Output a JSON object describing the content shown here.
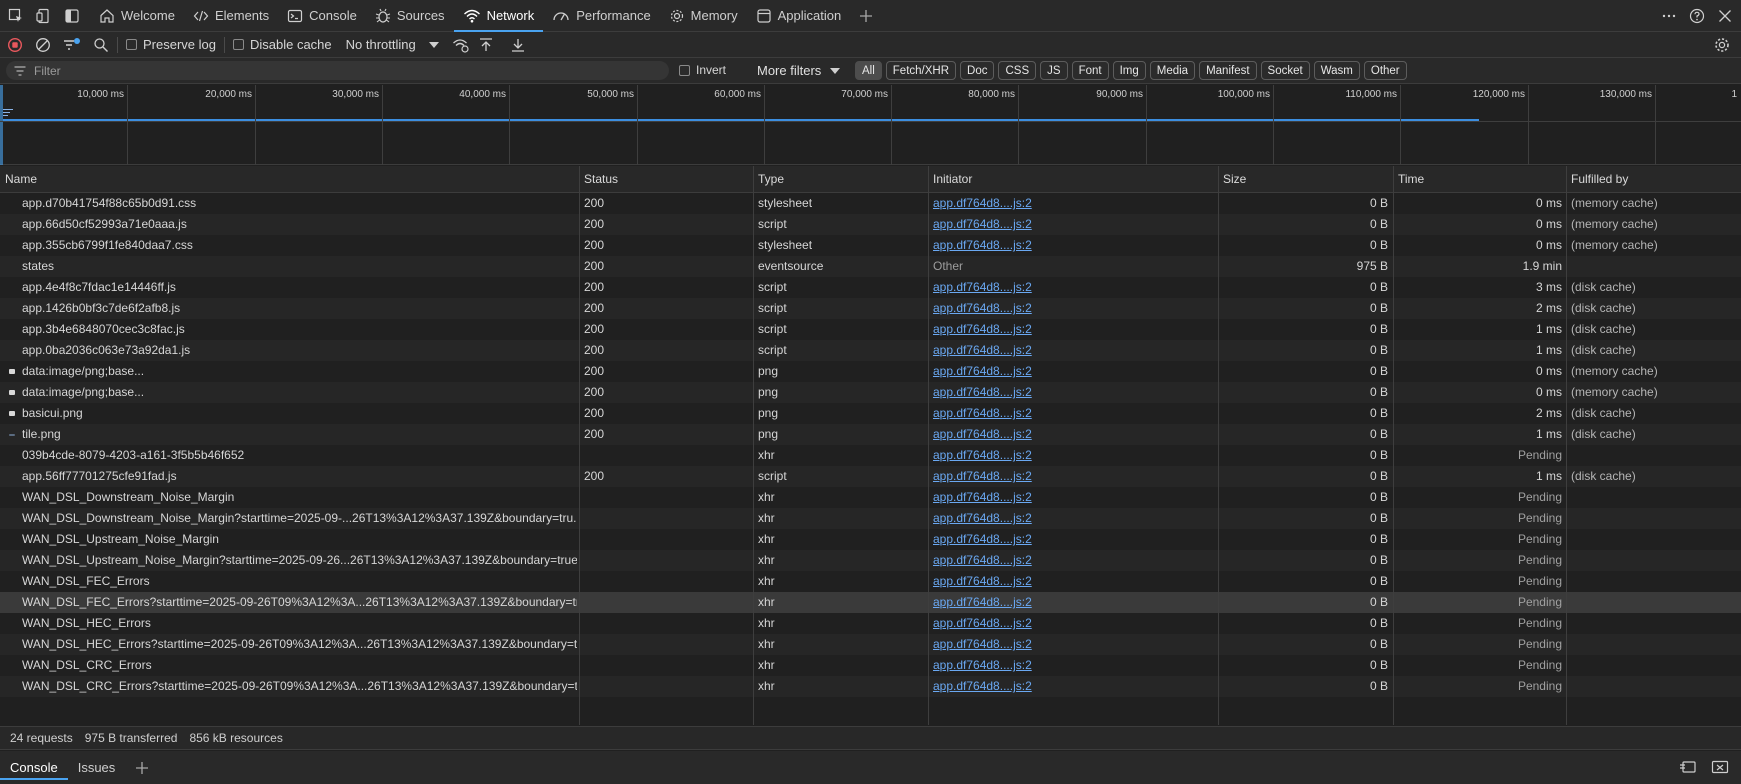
{
  "tabs": [
    {
      "label": "Welcome",
      "icon": "home-icon"
    },
    {
      "label": "Elements",
      "icon": "code-icon"
    },
    {
      "label": "Console",
      "icon": "console-icon"
    },
    {
      "label": "Sources",
      "icon": "bug-icon"
    },
    {
      "label": "Network",
      "icon": "wifi-icon",
      "active": true
    },
    {
      "label": "Performance",
      "icon": "gauge-icon"
    },
    {
      "label": "Memory",
      "icon": "gear-icon"
    },
    {
      "label": "Application",
      "icon": "app-icon"
    }
  ],
  "toolbar": {
    "preserve_log": "Preserve log",
    "disable_cache": "Disable cache",
    "throttling": "No throttling"
  },
  "filterbar": {
    "filter_placeholder": "Filter",
    "invert": "Invert",
    "more_filters": "More filters",
    "chips": [
      "All",
      "Fetch/XHR",
      "Doc",
      "CSS",
      "JS",
      "Font",
      "Img",
      "Media",
      "Manifest",
      "Socket",
      "Wasm",
      "Other"
    ],
    "active_chip": "All"
  },
  "overview": {
    "ticks": [
      "10,000 ms",
      "20,000 ms",
      "30,000 ms",
      "40,000 ms",
      "50,000 ms",
      "60,000 ms",
      "70,000 ms",
      "80,000 ms",
      "90,000 ms",
      "100,000 ms",
      "110,000 ms",
      "120,000 ms",
      "130,000 ms",
      "1"
    ]
  },
  "table": {
    "columns": [
      "Name",
      "Status",
      "Type",
      "Initiator",
      "Size",
      "Time",
      "Fulfilled by"
    ],
    "rows": [
      {
        "name": "app.d70b41754f88c65b0d91.css",
        "status": "200",
        "type": "stylesheet",
        "initiator": "app.df764d8....js:2",
        "size": "0 B",
        "time": "0 ms",
        "fulfilled": "(memory cache)",
        "icon": ""
      },
      {
        "name": "app.66d50cf52993a71e0aaa.js",
        "status": "200",
        "type": "script",
        "initiator": "app.df764d8....js:2",
        "size": "0 B",
        "time": "0 ms",
        "fulfilled": "(memory cache)",
        "icon": ""
      },
      {
        "name": "app.355cb6799f1fe840daa7.css",
        "status": "200",
        "type": "stylesheet",
        "initiator": "app.df764d8....js:2",
        "size": "0 B",
        "time": "0 ms",
        "fulfilled": "(memory cache)",
        "icon": ""
      },
      {
        "name": "states",
        "status": "200",
        "type": "eventsource",
        "initiator": "Other",
        "size": "975 B",
        "time": "1.9 min",
        "fulfilled": "",
        "icon": ""
      },
      {
        "name": "app.4e4f8c7fdac1e14446ff.js",
        "status": "200",
        "type": "script",
        "initiator": "app.df764d8....js:2",
        "size": "0 B",
        "time": "3 ms",
        "fulfilled": "(disk cache)",
        "icon": ""
      },
      {
        "name": "app.1426b0bf3c7de6f2afb8.js",
        "status": "200",
        "type": "script",
        "initiator": "app.df764d8....js:2",
        "size": "0 B",
        "time": "2 ms",
        "fulfilled": "(disk cache)",
        "icon": ""
      },
      {
        "name": "app.3b4e6848070cec3c8fac.js",
        "status": "200",
        "type": "script",
        "initiator": "app.df764d8....js:2",
        "size": "0 B",
        "time": "1 ms",
        "fulfilled": "(disk cache)",
        "icon": ""
      },
      {
        "name": "app.0ba2036c063e73a92da1.js",
        "status": "200",
        "type": "script",
        "initiator": "app.df764d8....js:2",
        "size": "0 B",
        "time": "1 ms",
        "fulfilled": "(disk cache)",
        "icon": ""
      },
      {
        "name": "data:image/png;base...",
        "status": "200",
        "type": "png",
        "initiator": "app.df764d8....js:2",
        "size": "0 B",
        "time": "0 ms",
        "fulfilled": "(memory cache)",
        "icon": "image"
      },
      {
        "name": "data:image/png;base...",
        "status": "200",
        "type": "png",
        "initiator": "app.df764d8....js:2",
        "size": "0 B",
        "time": "0 ms",
        "fulfilled": "(memory cache)",
        "icon": "image"
      },
      {
        "name": "basicui.png",
        "status": "200",
        "type": "png",
        "initiator": "app.df764d8....js:2",
        "size": "0 B",
        "time": "2 ms",
        "fulfilled": "(disk cache)",
        "icon": "image"
      },
      {
        "name": "tile.png",
        "status": "200",
        "type": "png",
        "initiator": "app.df764d8....js:2",
        "size": "0 B",
        "time": "1 ms",
        "fulfilled": "(disk cache)",
        "icon": "tile"
      },
      {
        "name": "039b4cde-8079-4203-a161-3f5b5b46f652",
        "status": "",
        "type": "xhr",
        "initiator": "app.df764d8....js:2",
        "size": "0 B",
        "time": "Pending",
        "fulfilled": "",
        "icon": ""
      },
      {
        "name": "app.56ff77701275cfe91fad.js",
        "status": "200",
        "type": "script",
        "initiator": "app.df764d8....js:2",
        "size": "0 B",
        "time": "1 ms",
        "fulfilled": "(disk cache)",
        "icon": ""
      },
      {
        "name": "WAN_DSL_Downstream_Noise_Margin",
        "status": "",
        "type": "xhr",
        "initiator": "app.df764d8....js:2",
        "size": "0 B",
        "time": "Pending",
        "fulfilled": "",
        "icon": ""
      },
      {
        "name": "WAN_DSL_Downstream_Noise_Margin?starttime=2025-09-...26T13%3A12%3A37.139Z&boundary=tru...",
        "status": "",
        "type": "xhr",
        "initiator": "app.df764d8....js:2",
        "size": "0 B",
        "time": "Pending",
        "fulfilled": "",
        "icon": ""
      },
      {
        "name": "WAN_DSL_Upstream_Noise_Margin",
        "status": "",
        "type": "xhr",
        "initiator": "app.df764d8....js:2",
        "size": "0 B",
        "time": "Pending",
        "fulfilled": "",
        "icon": ""
      },
      {
        "name": "WAN_DSL_Upstream_Noise_Margin?starttime=2025-09-26...26T13%3A12%3A37.139Z&boundary=true...",
        "status": "",
        "type": "xhr",
        "initiator": "app.df764d8....js:2",
        "size": "0 B",
        "time": "Pending",
        "fulfilled": "",
        "icon": ""
      },
      {
        "name": "WAN_DSL_FEC_Errors",
        "status": "",
        "type": "xhr",
        "initiator": "app.df764d8....js:2",
        "size": "0 B",
        "time": "Pending",
        "fulfilled": "",
        "icon": ""
      },
      {
        "name": "WAN_DSL_FEC_Errors?starttime=2025-09-26T09%3A12%3A...26T13%3A12%3A37.139Z&boundary=tru...",
        "status": "",
        "type": "xhr",
        "initiator": "app.df764d8....js:2",
        "size": "0 B",
        "time": "Pending",
        "fulfilled": "",
        "icon": "",
        "highlight": true
      },
      {
        "name": "WAN_DSL_HEC_Errors",
        "status": "",
        "type": "xhr",
        "initiator": "app.df764d8....js:2",
        "size": "0 B",
        "time": "Pending",
        "fulfilled": "",
        "icon": ""
      },
      {
        "name": "WAN_DSL_HEC_Errors?starttime=2025-09-26T09%3A12%3A...26T13%3A12%3A37.139Z&boundary=tr...",
        "status": "",
        "type": "xhr",
        "initiator": "app.df764d8....js:2",
        "size": "0 B",
        "time": "Pending",
        "fulfilled": "",
        "icon": ""
      },
      {
        "name": "WAN_DSL_CRC_Errors",
        "status": "",
        "type": "xhr",
        "initiator": "app.df764d8....js:2",
        "size": "0 B",
        "time": "Pending",
        "fulfilled": "",
        "icon": ""
      },
      {
        "name": "WAN_DSL_CRC_Errors?starttime=2025-09-26T09%3A12%3A...26T13%3A12%3A37.139Z&boundary=tr...",
        "status": "",
        "type": "xhr",
        "initiator": "app.df764d8....js:2",
        "size": "0 B",
        "time": "Pending",
        "fulfilled": "",
        "icon": ""
      }
    ]
  },
  "statusbar": {
    "requests": "24 requests",
    "transferred": "975 B transferred",
    "resources": "856 kB resources"
  },
  "drawer": {
    "tabs": [
      "Console",
      "Issues"
    ],
    "active": "Console"
  },
  "colors": {
    "accent": "#4aa3f0",
    "link": "#6aa8f2",
    "record": "#e8585d"
  }
}
